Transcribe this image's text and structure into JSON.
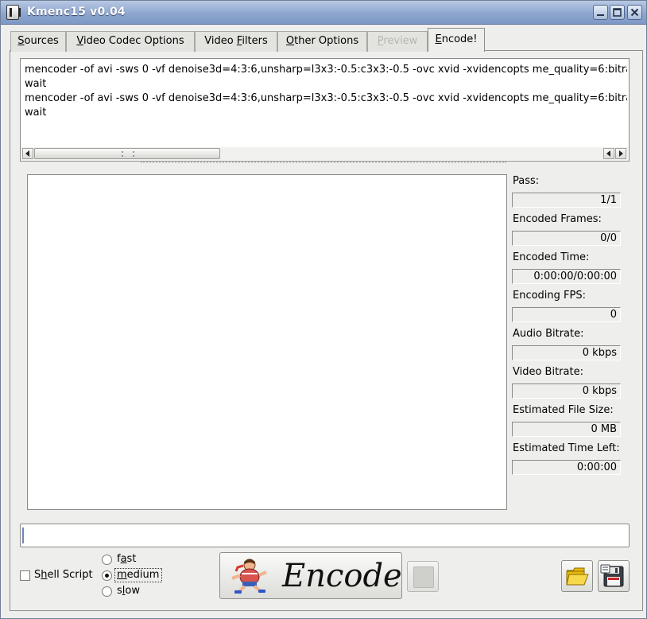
{
  "window": {
    "title": "Kmenc15 v0.04",
    "controls": {
      "minimize": "_",
      "maximize": "□",
      "close": "✕"
    }
  },
  "tabs": [
    {
      "label": "Sources",
      "mnemonic": "S",
      "rest": "ources"
    },
    {
      "label": "Video Codec Options",
      "mnemonic": "V",
      "rest": "ideo Codec Options"
    },
    {
      "label": "Video Filters",
      "pre": "Video ",
      "mnemonic": "F",
      "rest": "ilters"
    },
    {
      "label": "Other Options",
      "mnemonic": "O",
      "rest": "ther Options"
    },
    {
      "label": "Preview",
      "mnemonic": "P",
      "rest": "review",
      "disabled": true
    },
    {
      "label": "Encode!",
      "mnemonic": "E",
      "rest": "ncode!",
      "active": true
    }
  ],
  "commands": {
    "lines": [
      "mencoder -of avi -sws 0 -vf denoise3d=4:3:6,unsharp=l3x3:-0.5:c3x3:-0.5 -ovc xvid -xvidencopts me_quality=6:bitra",
      "wait",
      "mencoder -of avi -sws 0 -vf denoise3d=4:3:6,unsharp=l3x3:-0.5:c3x3:-0.5 -ovc xvid -xvidencopts me_quality=6:bitra",
      "wait"
    ]
  },
  "log": {
    "text": ""
  },
  "stats": [
    {
      "label": "Pass:",
      "value": "1/1"
    },
    {
      "label": "Encoded Frames:",
      "value": "0/0"
    },
    {
      "label": "Encoded Time:",
      "value": "0:00:00/0:00:00"
    },
    {
      "label": "Encoding FPS:",
      "value": "0"
    },
    {
      "label": "Audio Bitrate:",
      "value": "0 kbps"
    },
    {
      "label": "Video Bitrate:",
      "value": "0 kbps"
    },
    {
      "label": "Estimated File Size:",
      "value": "0 MB"
    },
    {
      "label": "Estimated Time Left:",
      "value": "0:00:00"
    }
  ],
  "progress": {
    "value": 0
  },
  "options": {
    "shell_script": {
      "label_pre": "S",
      "label_mn": "h",
      "label_rest": "ell Script",
      "checked": false
    },
    "speed": [
      {
        "label_pre": "f",
        "label_mn": "a",
        "label_rest": "st",
        "checked": false
      },
      {
        "label_pre": "",
        "label_mn": "m",
        "label_rest": "edium",
        "checked": true
      },
      {
        "label_pre": "s",
        "label_mn": "l",
        "label_rest": "ow",
        "checked": false
      }
    ]
  },
  "actions": {
    "encode_label": "Encode",
    "runner_icon": "running-mascot-icon",
    "stop_icon": "stop-icon",
    "open_icon": "open-folder-icon",
    "save_icon": "save-floppy-icon"
  },
  "colors": {
    "titlebar": "#8ea6cf",
    "window_bg": "#eeeeec",
    "folder_yellow": "#f2c417",
    "floppy_red": "#c8262c"
  }
}
